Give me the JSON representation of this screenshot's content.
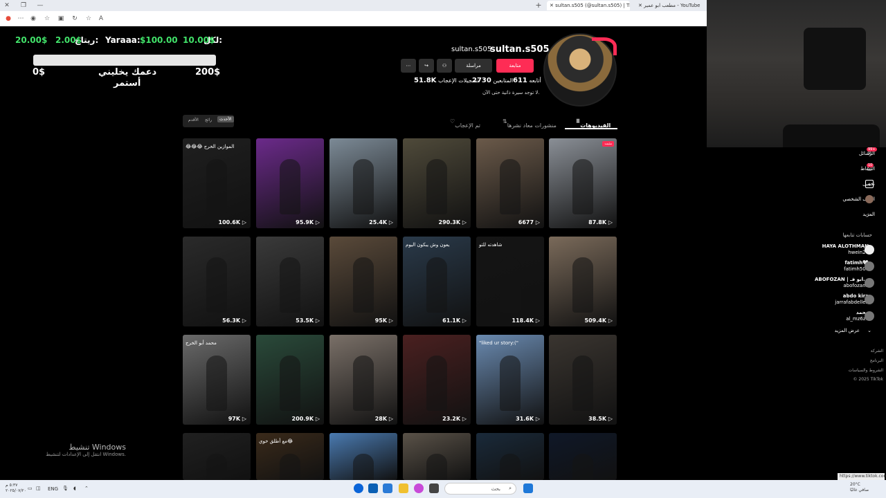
{
  "browser": {
    "tabs": [
      {
        "title": "مطعب ابو عمير - YouTube"
      },
      {
        "title": "sultan.s505 (@sultan.s505) | TikTok"
      }
    ],
    "new_tab": "+",
    "url_hint": "",
    "status_url": "https://www.tiktok.com"
  },
  "overlay": {
    "goal_label": "لكل:",
    "goal_amount": "10.00$",
    "yaraaa_label": "Yaraaa:",
    "yaraaa_amount": "$100.00",
    "rebaj_label": "ريتاج:",
    "rebaj_amount": "2.00$",
    "small_amount": "20.00$",
    "progress_percent": 0,
    "left_value": "0$",
    "right_value": "200$",
    "caption_line1": "دعمك يخليني",
    "caption_line2": "أستمر"
  },
  "profile": {
    "username": "sultan.s505",
    "nickname": "sultan.s505",
    "follow_label": "متابعة",
    "message_label": "مراسلة",
    "following_label": "أتابعه",
    "following_count": "611",
    "followers_label": "المتابعين",
    "followers_count": "2730",
    "likes_label": "تسجيلات الإعجاب",
    "likes_count": "51.8K",
    "bio": "لا توجد سيرة ذاتية حتى الآن."
  },
  "content_tabs": {
    "videos": "الفيديوهات",
    "reposts": "منشورات معاد نشرها",
    "liked": "تم الإعجاب"
  },
  "sort": {
    "latest": "الأحدث",
    "popular": "رائج",
    "oldest": "الأقدم"
  },
  "videos": [
    {
      "views": "87.8K",
      "badge": "مثبت",
      "color": "#8a8f96"
    },
    {
      "views": "6677",
      "color": "#6b5a4a"
    },
    {
      "views": "290.3K",
      "color": "#4f4a3a"
    },
    {
      "views": "25.4K",
      "color": "#7c8a96"
    },
    {
      "views": "95.9K",
      "color": "#6b2a8a"
    },
    {
      "views": "100.6K",
      "caption": "😂😂😂 الموازين الخرج",
      "color": "#1f1f1f"
    },
    {
      "views": "509.4K",
      "color": "#7a6a5a"
    },
    {
      "views": "118.4K",
      "caption": "شاهدته للتو",
      "color": "#151515"
    },
    {
      "views": "61.1K",
      "caption": "يعون وش يبكون اليوم",
      "color": "#2a3a4a"
    },
    {
      "views": "95K",
      "color": "#5a4a3a"
    },
    {
      "views": "53.5K",
      "color": "#3a3a3a"
    },
    {
      "views": "56.3K",
      "color": "#2a2a2a"
    },
    {
      "views": "38.5K",
      "color": "#3a3530"
    },
    {
      "views": "31.6K",
      "caption": "\"liked ur story:(\"",
      "color": "#6a8ab0"
    },
    {
      "views": "23.2K",
      "color": "#4a2020"
    },
    {
      "views": "28K",
      "color": "#7a7068"
    },
    {
      "views": "200.9K",
      "color": "#2a4a3a"
    },
    {
      "views": "97K",
      "caption": "محمد أبو الخرج",
      "color": "#6a6a6a"
    },
    {
      "views": "",
      "color": "#101828"
    },
    {
      "views": "",
      "color": "#1a2a3a"
    },
    {
      "views": "",
      "color": "#5a5248"
    },
    {
      "views": "",
      "color": "#4a7ab0"
    },
    {
      "views": "",
      "caption": "مع أطلق خوي😂",
      "color": "#3a2a1a"
    },
    {
      "views": "",
      "color": "#202020"
    }
  ],
  "sidebar": {
    "messages": "الرسائل",
    "messages_badge": "99+",
    "activity": "النشاط",
    "activity_badge": "10",
    "upload": "تحميل",
    "profile": "الملف الشخصي",
    "more": "المزيد",
    "following_title": "حسابات تتابعها",
    "accounts": [
      {
        "name": "HAYA ALOTHMAN",
        "handle": "hwein27"
      },
      {
        "name": "fatimh🤍",
        "handle": "fatimh50o"
      },
      {
        "name": "ABOFOZAN | ابو فـ...",
        "handle": "abofozan1"
      },
      {
        "name": "abdo kira",
        "handle": "jarrafabdelleh"
      },
      {
        "name": "محمد",
        "handle": "al_mz6z6"
      }
    ],
    "see_more": "عرض المزيد",
    "footer": [
      "الشركة",
      "البرنامج",
      "الشروط والسياسات",
      "© 2025 TikTok"
    ]
  },
  "windows": {
    "activate_title": "تنشيط Windows",
    "activate_sub": "انتقل إلى الإعدادات لتنشيط Windows."
  },
  "taskbar": {
    "search": "بحث",
    "lang": "ENG",
    "time": "٥:٣٧ م",
    "date": "٢٠٢٥/٠٧/٢٠",
    "weather": "20°C",
    "weather_sub": "صافي غالبًا"
  }
}
